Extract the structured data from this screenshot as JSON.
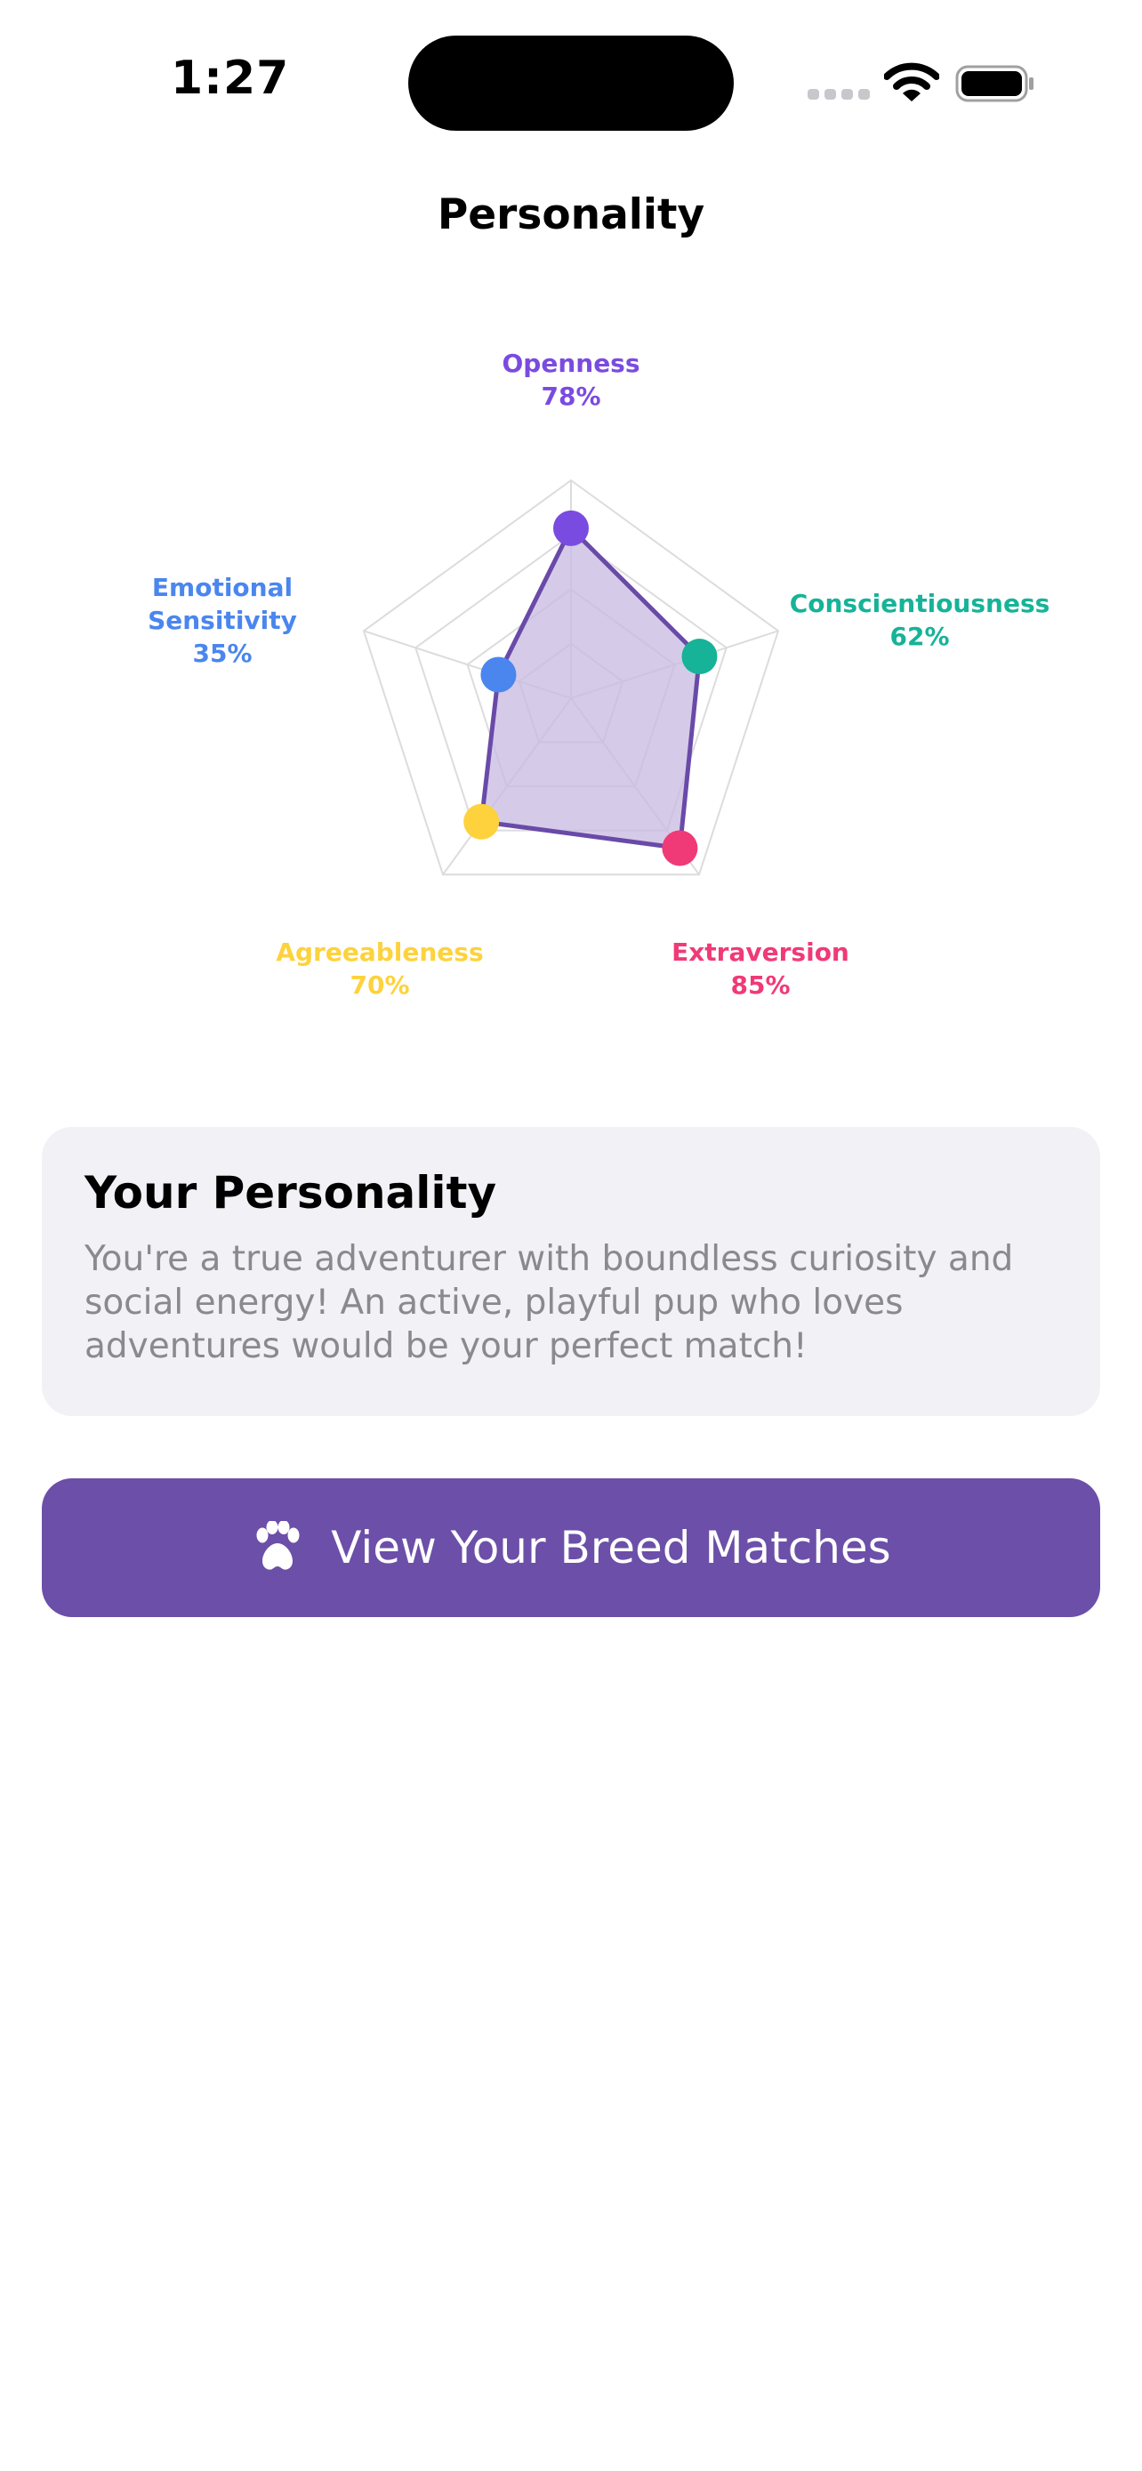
{
  "status_bar": {
    "time": "1:27",
    "icons": [
      "signal-icon",
      "wifi-icon",
      "battery-icon"
    ]
  },
  "header": {
    "title": "Personality"
  },
  "chart_data": {
    "type": "radar",
    "range": [
      0,
      100
    ],
    "grid_rings": 4,
    "grid": true,
    "fill_color": "#c9bde3",
    "line_color": "#6a4aa8",
    "axes": [
      {
        "name": "Openness",
        "value": 78,
        "label": "78%",
        "color": "#7a4be0"
      },
      {
        "name": "Conscientiousness",
        "value": 62,
        "label": "62%",
        "color": "#16b398"
      },
      {
        "name": "Extraversion",
        "value": 85,
        "label": "85%",
        "color": "#f03a78"
      },
      {
        "name": "Agreeableness",
        "value": 70,
        "label": "70%",
        "color": "#fdd23c"
      },
      {
        "name": "Emotional Sensitivity",
        "value": 35,
        "label": "35%",
        "color": "#4a86ee"
      }
    ]
  },
  "summary_card": {
    "title": "Your Personality",
    "text": "You're a true adventurer with boundless curiosity and social energy! An active, playful pup who loves adventures would be your perfect match!"
  },
  "cta": {
    "label": "View Your Breed Matches",
    "icon": "paw-icon",
    "color": "#6c4fa8"
  }
}
